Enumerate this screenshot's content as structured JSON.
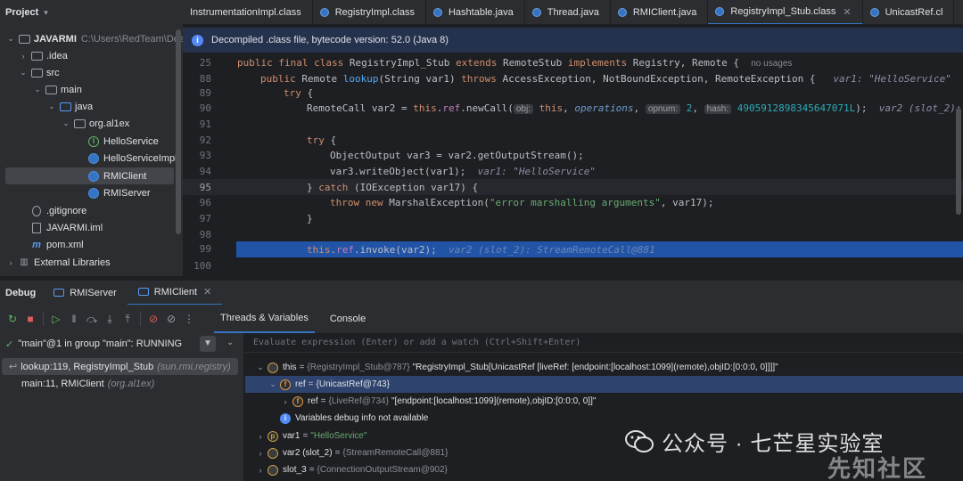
{
  "project": {
    "header": "Project",
    "tree": [
      {
        "label": "JAVARMI",
        "path": "C:\\Users\\RedTeam\\Desk"
      },
      {
        "label": ".idea"
      },
      {
        "label": "src"
      },
      {
        "label": "main"
      },
      {
        "label": "java"
      },
      {
        "label": "org.al1ex"
      },
      {
        "label": "HelloService"
      },
      {
        "label": "HelloServiceImpl"
      },
      {
        "label": "RMIClient"
      },
      {
        "label": "RMIServer"
      },
      {
        "label": ".gitignore"
      },
      {
        "label": "JAVARMI.iml"
      },
      {
        "label": "pom.xml"
      },
      {
        "label": "External Libraries"
      }
    ]
  },
  "editor": {
    "tabs": [
      "InstrumentationImpl.class",
      "RegistryImpl.class",
      "Hashtable.java",
      "Thread.java",
      "RMIClient.java",
      "RegistryImpl_Stub.class",
      "UnicastRef.cl"
    ],
    "active_tab": "RegistryImpl_Stub.class",
    "banner": "Decompiled .class file, bytecode version: 52.0 (Java 8)",
    "lines": {
      "l25": {
        "num": "25",
        "k1": "public final class ",
        "cls": "RegistryImpl_Stub ",
        "k2": "extends ",
        "t1": "RemoteStub ",
        "k3": "implements ",
        "t2": "Registry, Remote {",
        "usages": "no usages"
      },
      "l88": {
        "num": "88",
        "k1": "public ",
        "t1": "Remote ",
        "fn": "lookup",
        "t2": "(String var1) ",
        "k2": "throws ",
        "t3": "AccessException, NotBoundException, RemoteException {",
        "inl": "var1: \"HelloService\""
      },
      "l89": {
        "num": "89",
        "k1": "try ",
        "t1": "{"
      },
      "l90": {
        "num": "90",
        "t1": "RemoteCall var2 = ",
        "k1": "this",
        "t2": ".",
        "f1": "ref",
        "t3": ".newCall(",
        "h1": "obj:",
        "k2": "this",
        "t4": ", ",
        "it1": "operations",
        "t5": ", ",
        "h2": "opnum:",
        "n1": "2",
        "t6": ", ",
        "h3": "hash:",
        "n2": "4905912898345647071L",
        "t7": ");",
        "inl": "var2 (slot_2): S"
      },
      "l91": {
        "num": "91"
      },
      "l92": {
        "num": "92",
        "k1": "try ",
        "t1": "{"
      },
      "l93": {
        "num": "93",
        "t1": "ObjectOutput var3 = var2.getOutputStream();"
      },
      "l94": {
        "num": "94",
        "t1": "var3.writeObject(var1);",
        "inl": "var1: \"HelloService\""
      },
      "l95": {
        "num": "95",
        "t1": "} ",
        "k1": "catch ",
        "t2": "(IOException var17) {"
      },
      "l96": {
        "num": "96",
        "k1": "throw new ",
        "t1": "MarshalException(",
        "s1": "\"error marshalling arguments\"",
        "t2": ", var17);"
      },
      "l97": {
        "num": "97",
        "t1": "}"
      },
      "l98": {
        "num": "98"
      },
      "l99": {
        "num": "99",
        "k1": "this",
        "t1": ".",
        "f1": "ref",
        "t2": ".invoke(var2);",
        "inl": "var2 (slot_2): StreamRemoteCall@881"
      },
      "l100": {
        "num": "100"
      }
    }
  },
  "debug": {
    "title": "Debug",
    "tabs": [
      "RMIServer",
      "RMIClient"
    ],
    "subtabs": [
      "Threads & Variables",
      "Console"
    ],
    "thread": "\"main\"@1 in group \"main\": RUNNING",
    "frames": [
      {
        "method": "lookup:119, RegistryImpl_Stub",
        "pkg": "(sun.rmi.registry)"
      },
      {
        "method": "main:11, RMIClient",
        "pkg": "(org.al1ex)"
      }
    ],
    "eval_placeholder": "Evaluate expression (Enter) or add a watch (Ctrl+Shift+Enter)",
    "vars": [
      {
        "name": "this",
        "eq": "=",
        "type": "{RegistryImpl_Stub@787}",
        "val": "\"RegistryImpl_Stub[UnicastRef [liveRef: [endpoint:[localhost:1099](remote),objID:[0:0:0, 0]]]]\""
      },
      {
        "name": "ref",
        "eq": "=",
        "type": "{UnicastRef@743}",
        "val": ""
      },
      {
        "name": "ref",
        "eq": "=",
        "type": "{LiveRef@734}",
        "val": "\"[endpoint:[localhost:1099](remote),objID:[0:0:0, 0]]\""
      },
      {
        "name": "Variables debug info not available",
        "eq": "",
        "type": "",
        "val": ""
      },
      {
        "name": "var1",
        "eq": "=",
        "type": "",
        "val": "\"HelloService\""
      },
      {
        "name": "var2 (slot_2)",
        "eq": "=",
        "type": "{StreamRemoteCall@881}",
        "val": ""
      },
      {
        "name": "slot_3",
        "eq": "=",
        "type": "{ConnectionOutputStream@902}",
        "val": ""
      }
    ]
  },
  "watermark": {
    "text": "公众号 · 七芒星实验室",
    "logo_text": "先知社区"
  }
}
